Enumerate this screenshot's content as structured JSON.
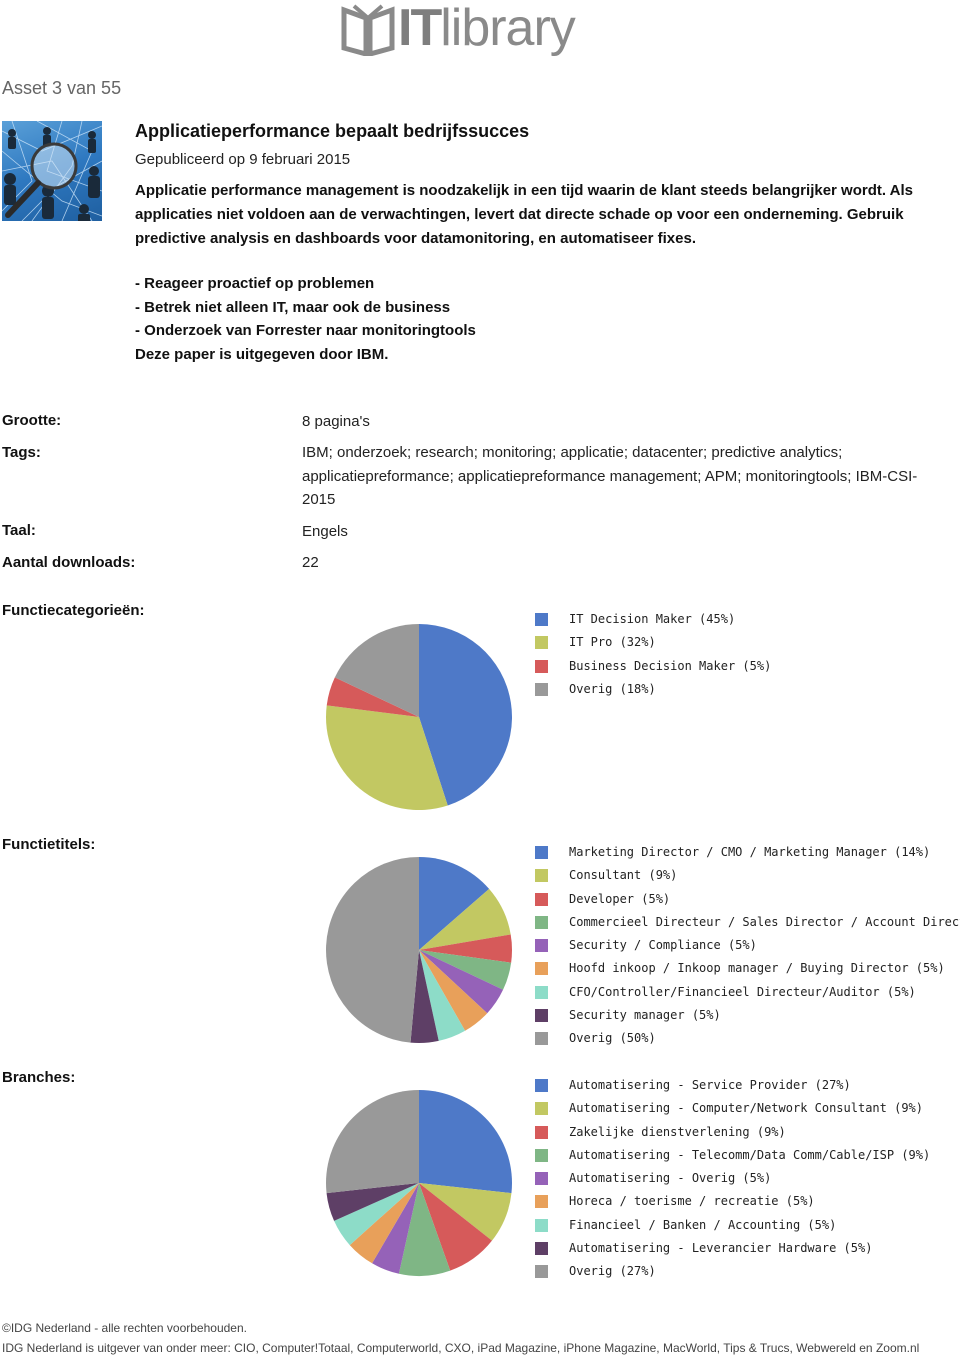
{
  "header": {
    "logo_it": "IT",
    "logo_library": "library",
    "asset_counter": "Asset 3 van 55"
  },
  "article": {
    "title": "Applicatieperformance bepaalt bedrijfssucces",
    "published": "Gepubliceerd op 9 februari 2015",
    "intro": "Applicatie performance management is noodzakelijk in een tijd waarin de klant steeds belangrijker wordt. Als applicaties niet voldoen aan de verwachtingen, levert dat directe schade op voor een onderneming. Gebruik predictive analysis en dashboards voor datamonitoring, en automatiseer fixes.",
    "bullets": [
      "-  Reageer proactief op problemen",
      "-  Betrek niet alleen IT, maar ook de business",
      "-  Onderzoek van Forrester naar monitoringtools"
    ],
    "publisher_note": "Deze paper is uitgegeven door IBM."
  },
  "meta": {
    "size_label": "Grootte:",
    "size_value": "8 pagina's",
    "tags_label": "Tags:",
    "tags_value": "IBM; onderzoek; research; monitoring; applicatie; datacenter; predictive analytics; applicatiepreformance; applicatiepreformance management; APM; monitoringtools; IBM-CSI-2015",
    "language_label": "Taal:",
    "language_value": "Engels",
    "downloads_label": "Aantal downloads:",
    "downloads_value": "22"
  },
  "sections": {
    "functiecategorieen": "Functiecategorieën:",
    "functietitels": "Functietitels:",
    "branches": "Branches:"
  },
  "chart_data": [
    {
      "type": "pie",
      "title": "Functiecategorieën",
      "categories": [
        "IT Decision Maker",
        "IT Pro",
        "Business Decision Maker",
        "Overig"
      ],
      "values": [
        45,
        32,
        5,
        18
      ],
      "labels": [
        "IT Decision Maker (45%)",
        "IT Pro (32%)",
        "Business Decision Maker (5%)",
        "Overig (18%)"
      ],
      "colors": [
        "#4e79c8",
        "#c2c862",
        "#d65a5a",
        "#999999"
      ],
      "legend": "right"
    },
    {
      "type": "pie",
      "title": "Functietitels",
      "categories": [
        "Marketing Director / CMO / Marketing Manager",
        "Consultant",
        "Developer",
        "Commercieel Directeur / Sales Director / Account Director",
        "Security / Compliance",
        "Hoofd inkoop / Inkoop manager / Buying Director",
        "CFO/Controller/Financieel Directeur/Auditor",
        "Security manager",
        "Overig"
      ],
      "values": [
        14,
        9,
        5,
        5,
        5,
        5,
        5,
        5,
        50
      ],
      "labels": [
        "Marketing Director / CMO / Marketing Manager (14%)",
        "Consultant (9%)",
        "Developer (5%)",
        "Commercieel Directeur / Sales Director / Account Directo",
        "Security / Compliance (5%)",
        "Hoofd inkoop / Inkoop manager / Buying Director (5%)",
        "CFO/Controller/Financieel Directeur/Auditor (5%)",
        "Security manager (5%)",
        "Overig (50%)"
      ],
      "colors": [
        "#4e79c8",
        "#c2c862",
        "#d65a5a",
        "#7fb685",
        "#9562b8",
        "#e8a05a",
        "#8ddcc8",
        "#5e3f66",
        "#999999"
      ],
      "legend": "right"
    },
    {
      "type": "pie",
      "title": "Branches",
      "categories": [
        "Automatisering - Service Provider",
        "Automatisering - Computer/Network Consultant",
        "Zakelijke dienstverlening",
        "Automatisering - Telecomm/Data Comm/Cable/ISP",
        "Automatisering - Overig",
        "Horeca / toerisme / recreatie",
        "Financieel / Banken / Accounting",
        "Automatisering - Leverancier Hardware",
        "Overig"
      ],
      "values": [
        27,
        9,
        9,
        9,
        5,
        5,
        5,
        5,
        27
      ],
      "labels": [
        "Automatisering - Service Provider (27%)",
        "Automatisering - Computer/Network Consultant (9%)",
        "Zakelijke dienstverlening (9%)",
        "Automatisering - Telecomm/Data Comm/Cable/ISP (9%)",
        "Automatisering - Overig (5%)",
        "Horeca / toerisme / recreatie (5%)",
        "Financieel / Banken / Accounting (5%)",
        "Automatisering - Leverancier Hardware (5%)",
        "Overig (27%)"
      ],
      "colors": [
        "#4e79c8",
        "#c2c862",
        "#d65a5a",
        "#7fb685",
        "#9562b8",
        "#e8a05a",
        "#8ddcc8",
        "#5e3f66",
        "#999999"
      ],
      "legend": "right"
    }
  ],
  "footer": {
    "copyright": "©IDG Nederland - alle rechten voorbehouden.",
    "publisher": "IDG Nederland is uitgever van onder meer: CIO, Computer!Totaal, Computerworld, CXO, iPad Magazine, iPhone Magazine, MacWorld, Tips & Trucs, Webwereld en Zoom.nl"
  }
}
